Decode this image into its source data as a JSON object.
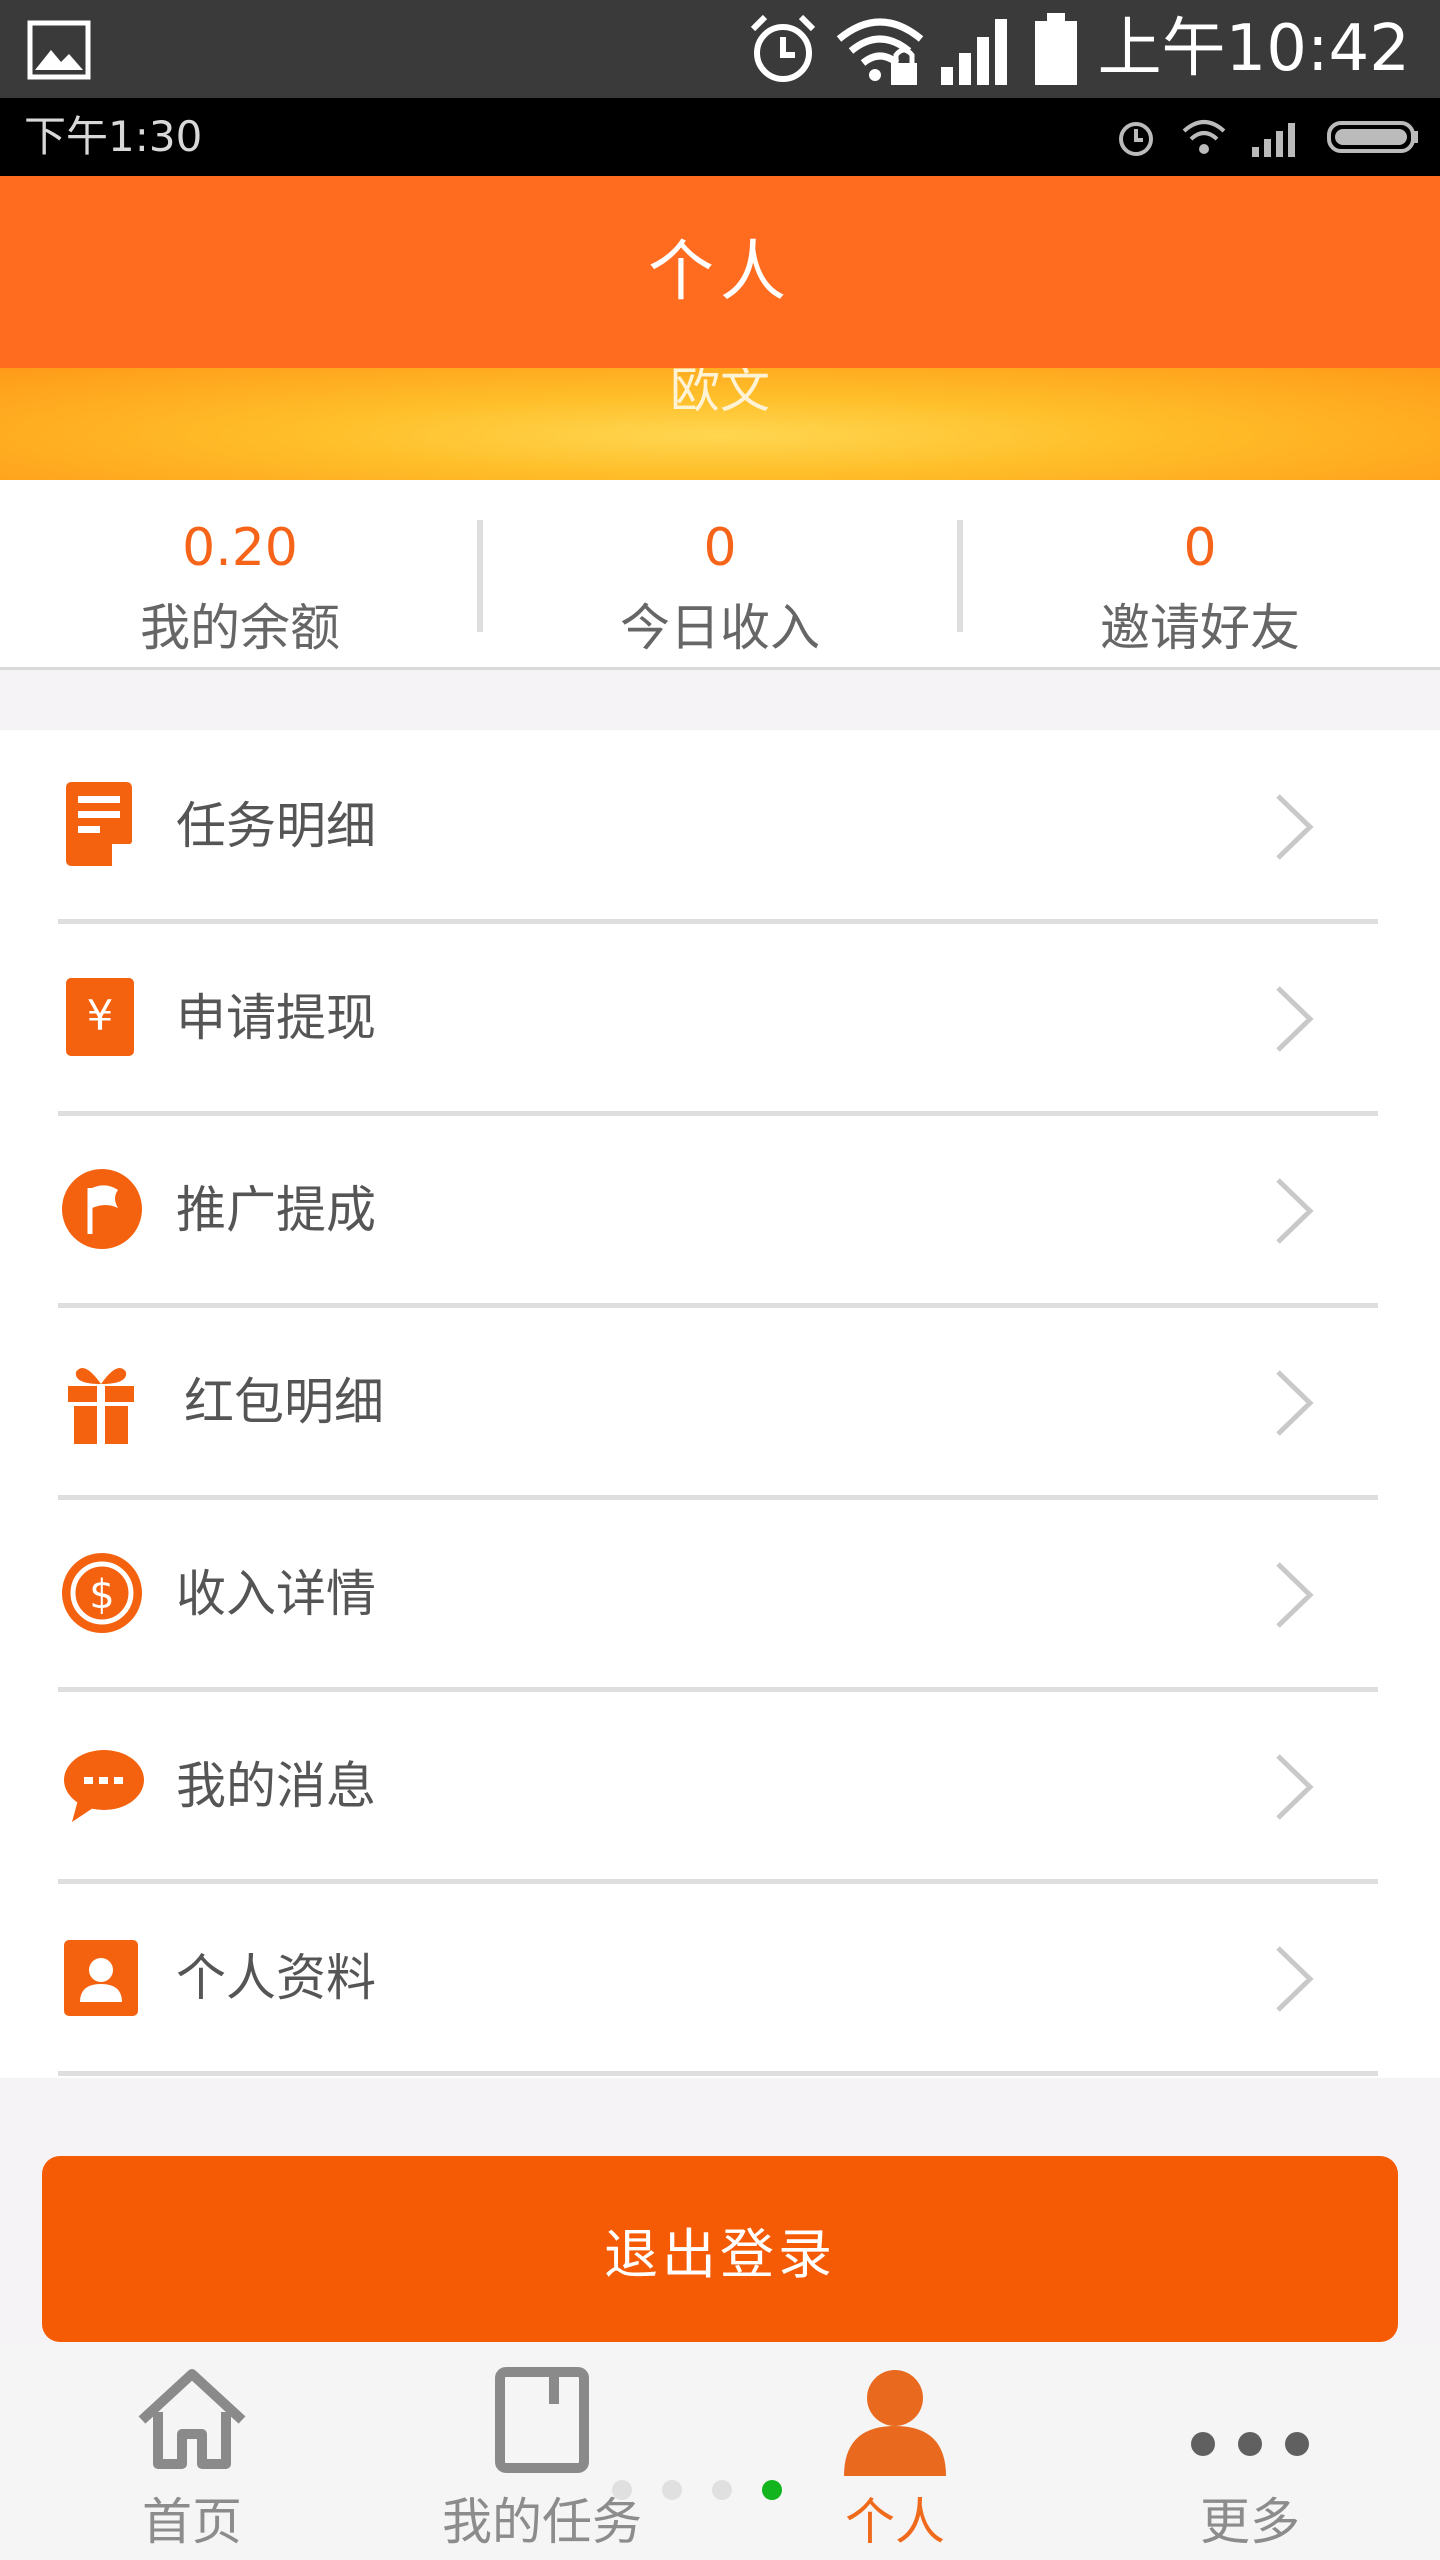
{
  "status_bar": {
    "time": "上午10:42"
  },
  "inner_status_bar": {
    "time": "下午1:30"
  },
  "header": {
    "title": "个人"
  },
  "profile": {
    "name": "欧文"
  },
  "stats": [
    {
      "value": "0.20",
      "label": "我的余额"
    },
    {
      "value": "0",
      "label": "今日收入"
    },
    {
      "value": "0",
      "label": "邀请好友"
    }
  ],
  "menu": [
    {
      "label": "任务明细",
      "icon": "task-list-icon"
    },
    {
      "label": "申请提现",
      "icon": "yuan-icon"
    },
    {
      "label": "推广提成",
      "icon": "flag-icon"
    },
    {
      "label": "红包明细",
      "icon": "gift-icon"
    },
    {
      "label": "收入详情",
      "icon": "dollar-coin-icon"
    },
    {
      "label": "我的消息",
      "icon": "message-icon"
    },
    {
      "label": "个人资料",
      "icon": "profile-card-icon"
    }
  ],
  "logout": {
    "label": "退出登录"
  },
  "nav": [
    {
      "label": "首页",
      "icon": "home-icon"
    },
    {
      "label": "我的任务",
      "icon": "notebook-icon"
    },
    {
      "label": "个人",
      "icon": "person-icon",
      "active": true
    },
    {
      "label": "更多",
      "icon": "more-icon"
    }
  ],
  "page_indicator": {
    "count": 4,
    "current": 4
  },
  "colors": {
    "accent": "#ff6b1f",
    "button": "#f55a04",
    "active_tab": "#f06a1c",
    "indicator": "#13b51f"
  }
}
